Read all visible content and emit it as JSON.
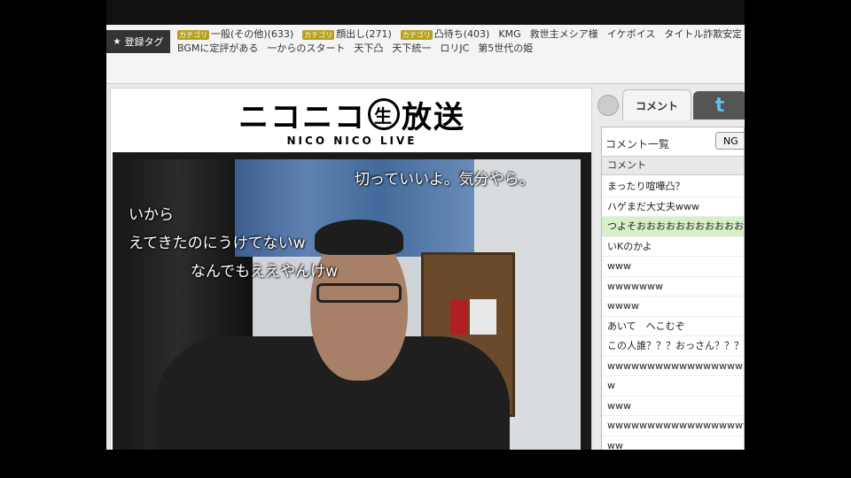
{
  "tags": {
    "header": "登録タグ",
    "row1": [
      {
        "badge": "カテゴリ",
        "label": "一般(その他)(633)"
      },
      {
        "badge": "カテゴリ",
        "label": "顔出し(271)"
      },
      {
        "badge": "カテゴリ",
        "label": "凸待ち(403)"
      },
      {
        "badge": "",
        "label": "KMG"
      },
      {
        "badge": "",
        "label": "救世主メシア様"
      },
      {
        "badge": "",
        "label": "イケボイス"
      },
      {
        "badge": "",
        "label": "タイトル詐欺安定"
      }
    ],
    "row2": [
      {
        "label": "BGMに定評がある"
      },
      {
        "label": "一からのスタート"
      },
      {
        "label": "天下凸"
      },
      {
        "label": "天下統一"
      },
      {
        "label": "ロリJC"
      },
      {
        "label": "第5世代の姫"
      }
    ]
  },
  "logo": {
    "main_pre": "ニコニコ",
    "main_nama": "生",
    "main_post": "放送",
    "sub": "NICO NICO LIVE"
  },
  "video": {
    "comments": [
      "切っていいよ。気分やら。",
      "いから",
      "えてきたのにうけてないw",
      "なんでもええやんけw"
    ]
  },
  "sidebar": {
    "tab_comment": "コメント",
    "twitter_icon": "t",
    "panel_title": "コメント一覧",
    "ng_button": "NG",
    "column_header": "コメント",
    "comments": [
      {
        "text": "まったり喧嘩凸？",
        "highlight": false
      },
      {
        "text": "ハゲまだ大丈夫www",
        "highlight": false
      },
      {
        "text": "つよそおおおおおおおおおおお",
        "highlight": true
      },
      {
        "text": "いKのかよ",
        "highlight": false
      },
      {
        "text": "www",
        "highlight": false
      },
      {
        "text": "wwwwwww",
        "highlight": false
      },
      {
        "text": "wwww",
        "highlight": false
      },
      {
        "text": "あいて　へこむぞ",
        "highlight": false
      },
      {
        "text": "この人誰？？？おっさん？？？",
        "highlight": false
      },
      {
        "text": "wwwwwwwwwwwwwwwww",
        "highlight": false
      },
      {
        "text": "w",
        "highlight": false
      },
      {
        "text": "www",
        "highlight": false
      },
      {
        "text": "wwwwwwwwwwwwwwwwwww",
        "highlight": false
      },
      {
        "text": "ww",
        "highlight": false
      }
    ]
  },
  "colors": {
    "accent_highlight": "#d8f0c8",
    "tag_badge": "#b8a020",
    "twitter": "#5cc0f0"
  }
}
